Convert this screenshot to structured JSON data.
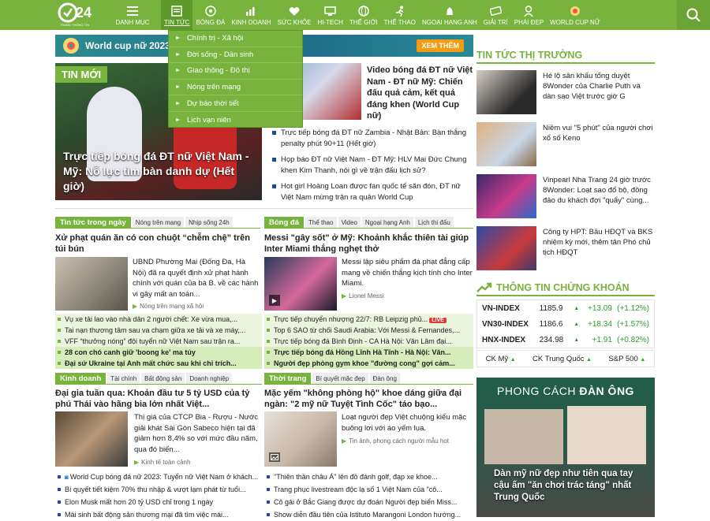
{
  "nav": {
    "first": {
      "label": "DANH MỤC"
    },
    "items": [
      {
        "label": "TIN TỨC"
      },
      {
        "label": "BÓNG ĐÁ"
      },
      {
        "label": "KINH DOANH"
      },
      {
        "label": "SỨC KHỎE"
      },
      {
        "label": "HI-TECH"
      },
      {
        "label": "THẾ GIỚI"
      },
      {
        "label": "THỂ THAO"
      },
      {
        "label": "NGOẠI HẠNG ANH"
      },
      {
        "label": "GIẢI TRÍ"
      },
      {
        "label": "PHÁI ĐẸP"
      },
      {
        "label": "WORLD CUP NỮ"
      }
    ]
  },
  "dropdown": {
    "items": [
      {
        "label": "Chính trị - Xã hội"
      },
      {
        "label": "Đời sống - Dân sinh"
      },
      {
        "label": "Giao thông - Đô thị"
      },
      {
        "label": "Nóng trên mạng"
      },
      {
        "label": "Dự báo thời tiết"
      },
      {
        "label": "Lịch vạn niên"
      }
    ]
  },
  "banner": {
    "title": "World cup nữ 2023",
    "more": "XEM THÊM"
  },
  "hero": {
    "tag": "TIN MỚI",
    "title": "Trực tiếp bóng đá ĐT nữ Việt Nam - Mỹ: Nỗ lực tìm bàn danh dự (Hết giờ)"
  },
  "topstory": {
    "title": "Video bóng đá ĐT nữ Việt Nam - ĐT nữ Mỹ: Chiến đấu quả cảm, kết quả đáng khen (World Cup nữ)",
    "list": [
      "Trực tiếp bóng đá ĐT nữ Zambia - Nhật Bản: Bàn thắng penalty phút 90+11 (Hết giờ)",
      "Họp báo ĐT nữ Việt Nam - ĐT Mỹ: HLV Mai Đức Chung khen Kim Thanh, nói gì về trận đấu lịch sử?",
      "Hot girl Hoàng Loan được fan quốc tế săn đón, ĐT nữ Việt Nam mừng trận ra quân World Cup"
    ]
  },
  "sec_tin": {
    "main": "Tin tức trong ngày",
    "subs": [
      "Nóng trên mạng",
      "Nhịp sống 24h"
    ],
    "title": "Xử phạt quán ăn có con chuột “chễm chệ” trên túi bún",
    "desc": "UBND Phường Mai (Đống Đa, Hà Nội) đã ra quyết định xử phạt hành chính với quán của bà B. về các hành vi gây mất an toàn...",
    "cat": "Nóng trên mạng xã hội",
    "list": [
      {
        "text": "Vụ xe tải lao vào nhà dân 2 người chết: Xe vừa mua,...",
        "hl": false
      },
      {
        "text": "Tai nạn thương tâm sau va chạm giữa xe tải và xe máy,...",
        "hl": false
      },
      {
        "text": "VFF “thưởng nóng” đội tuyển nữ Việt Nam sau trận ra...",
        "hl": false
      },
      {
        "text": "28 con chó canh giữ 'boong ke' ma túy",
        "hl": true
      },
      {
        "text": "Đại sứ Ukraine tại Anh mất chức sau khi chỉ trích...",
        "hl": true
      }
    ]
  },
  "sec_bong": {
    "main": "Bóng đá",
    "subs": [
      "Thể thao",
      "Video",
      "Ngoại hạng Anh",
      "Lịch thi đấu"
    ],
    "title": "Messi \"gây sốt\" ở Mỹ: Khoảnh khắc thiên tài giúp Inter Miami thắng nghẹt thở",
    "desc": "Messi lập siêu phẩm đá phạt đẳng cấp mang về chiến thắng kịch tính cho Inter Miami.",
    "cat": "Lionel Messi",
    "live": "LIVE",
    "list": [
      {
        "text": "Trực tiếp chuyển nhượng 22/7: RB Leipzig phủ...",
        "hl": false,
        "live": true
      },
      {
        "text": "Top 6 SAO từ chối Saudi Arabia: Với Messi & Fernandes,...",
        "hl": false
      },
      {
        "text": "Trực tiếp bóng đá Bình Định - CA Hà Nội: Văn Lâm đại...",
        "hl": false
      },
      {
        "text": "Trực tiếp bóng đá Hồng Lĩnh Hà Tĩnh - Hà Nội: Văn...",
        "hl": true
      },
      {
        "text": "Người đẹp phòng gym khoe \"đường cong\" gợi cảm...",
        "hl": true
      }
    ]
  },
  "sec_kinh": {
    "main": "Kinh doanh",
    "subs": [
      "Tài chính",
      "Bất động sản",
      "Doanh nghiệp"
    ],
    "title": "Đại gia tuần qua: Khoản đầu tư 5 tỷ USD của tỷ phú Thái vào hãng bia lớn nhất Việt...",
    "desc": "Thị giá của CTCP Bia - Rượu - Nước giải khát Sài Gòn Sabeco hiện tại đã giảm hơn 8,4% so với mức đầu năm, qua đó biến...",
    "cat": "Kinh tế toàn cảnh",
    "list": [
      "World Cup bóng đá nữ 2023: Tuyển nữ Việt Nam ở khách...",
      "Bí quyết tiết kiệm 70% thu nhập & vượt lạm phát từ tuổi...",
      "Elon Musk mất hơn 20 tỷ USD chỉ trong 1 ngày",
      "Mái sinh bất động sản thương mại đã tìm việc mái..."
    ]
  },
  "sec_thoi": {
    "main": "Thời trang",
    "subs": [
      "Bí quyết mặc đẹp",
      "Đàn ông"
    ],
    "title": "Mặc yếm \"không phòng hộ\" khoe dáng giữa đại ngàn: \"2 mỹ nữ Tuyệt Tình Cốc\" táo bạo...",
    "desc": "Loạt người đẹp Việt chuộng kiểu mặc buông lơi với áo yếm lụa.",
    "cat": "Tin ảnh, phong cách người mẫu hot",
    "list": [
      "\"Thiên thần châu Á\" lên đồ đánh golf, đạp xe khoe...",
      "Trang phục livestream độc lạ số 1 Việt Nam của \"cô...",
      "Cô gái ở Bắc Giang được dự đoán Người đẹp biển Miss...",
      "Show diễn đầu tiên của Istituto Marangoni London hướng..."
    ]
  },
  "market": {
    "header": "TIN TỨC THỊ TRƯỜNG",
    "items": [
      "Hé lộ sân khấu tổng duyệt 8Wonder của Charlie Puth và dàn sao Việt trước giờ G",
      "Niềm vui \"5 phút\" của người chơi xổ số Keno",
      "Vinpearl Nha Trang 24 giờ trước 8Wonder: Loạt sao đổ bộ, đồng đảo du khách đợi \"quẩy\" cùng...",
      "Công ty HPT: Bầu HĐQT và BKS nhiệm kỳ mới, thêm tân Phó chủ tịch HĐQT"
    ]
  },
  "stocks": {
    "header": "THÔNG TIN CHỨNG KHOÁN",
    "rows": [
      {
        "name": "VN-INDEX",
        "price": "1185.9",
        "change": "+13.09",
        "pct": "(+1.12%)"
      },
      {
        "name": "VN30-INDEX",
        "price": "1186.6",
        "change": "+18.34",
        "pct": "(+1.57%)"
      },
      {
        "name": "HNX-INDEX",
        "price": "234.98",
        "change": "+1.91",
        "pct": "(+0.82%)"
      }
    ],
    "tabs": [
      "CK Mỹ",
      "CK Trung Quốc",
      "S&P 500"
    ]
  },
  "fashion": {
    "header_a": "PHONG CÁCH",
    "header_b": "ĐÀN ÔNG",
    "title": "Dàn mỹ nữ đẹp như tiên qua tay cậu ấm \"ăn chơi trác táng\" nhất Trung Quốc"
  },
  "colors": {
    "brand": "#78b43d",
    "link_bullet": "#1a4aa0",
    "up": "#2e9e2e",
    "live": "#e53935"
  }
}
